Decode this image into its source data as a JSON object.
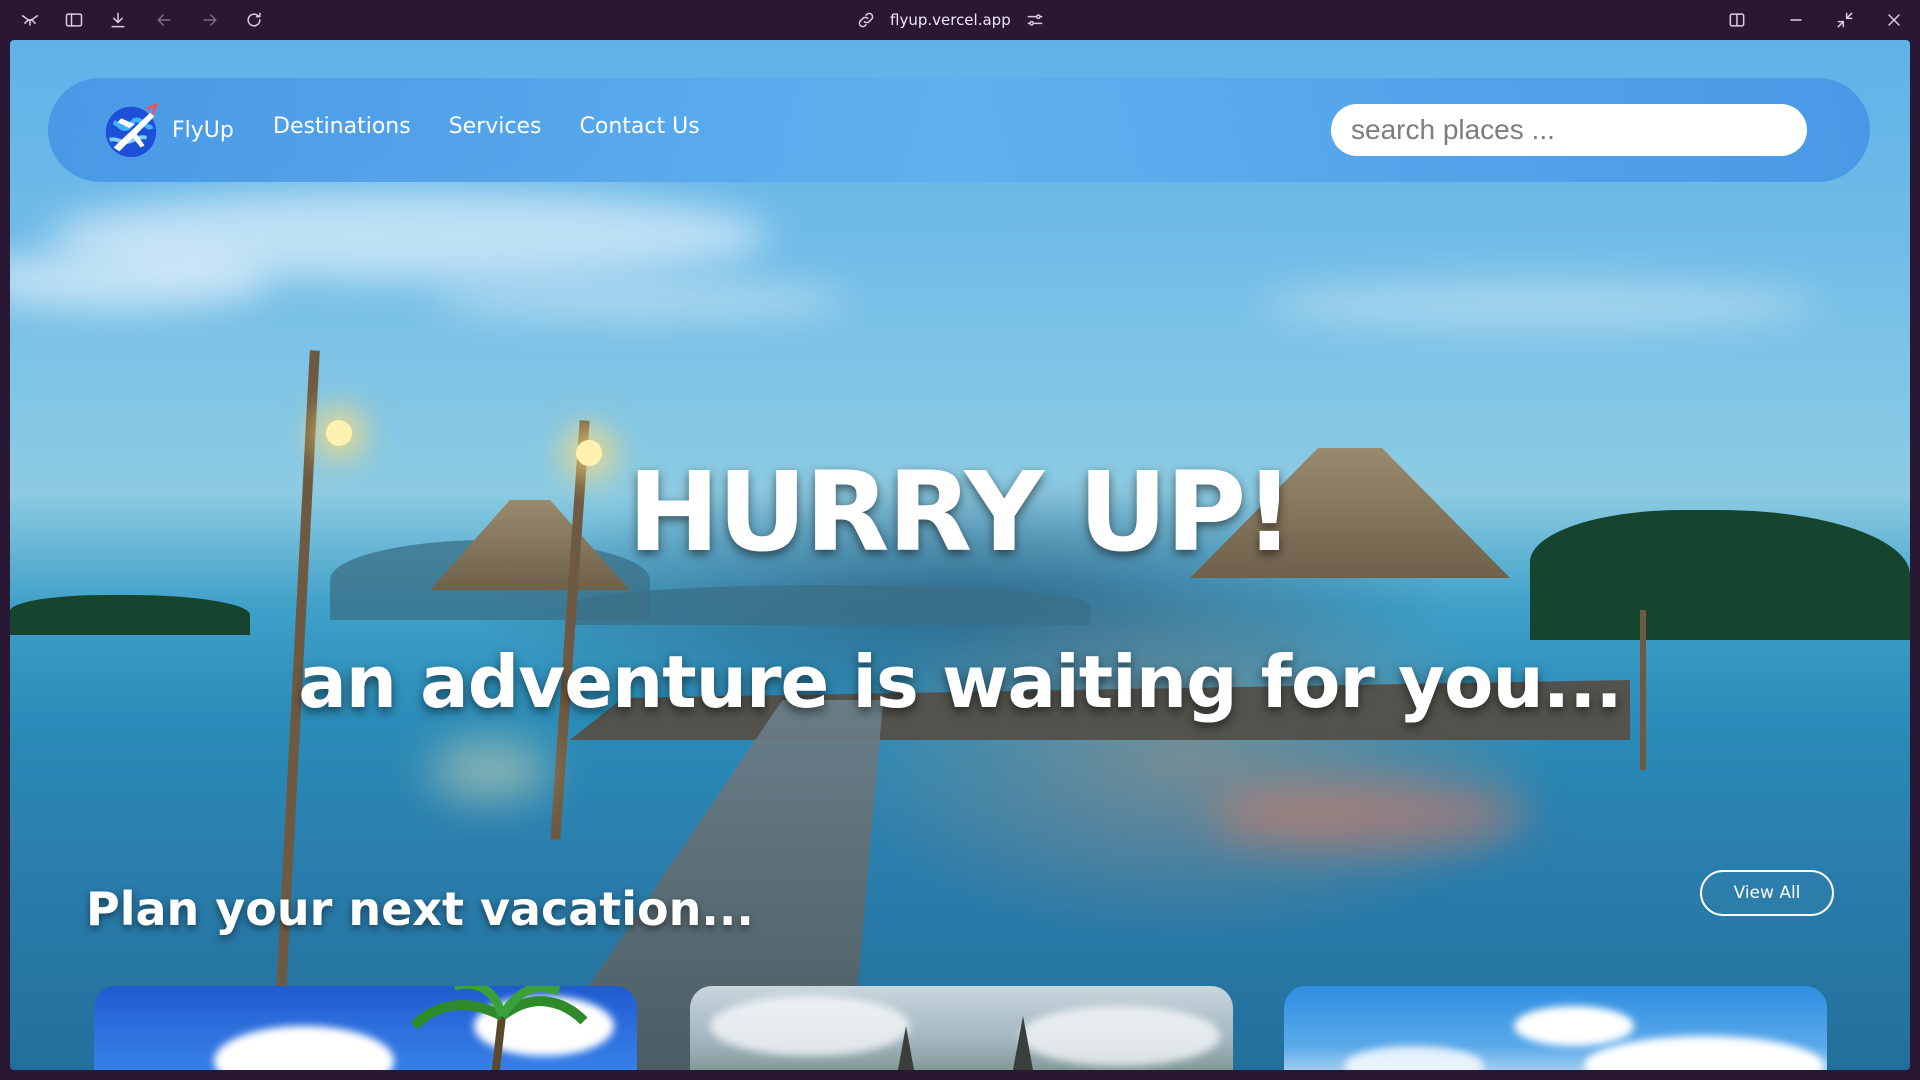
{
  "browser": {
    "url": "flyup.vercel.app",
    "icons": [
      "app-logo-icon",
      "sidebar-toggle-icon",
      "download-icon",
      "back-icon",
      "forward-icon",
      "reload-icon",
      "link-icon",
      "site-settings-icon",
      "split-view-icon",
      "minimize-icon",
      "restore-icon",
      "close-icon"
    ]
  },
  "navbar": {
    "brand": "FlyUp",
    "links": [
      "Destinations",
      "Services",
      "Contact Us"
    ],
    "search_placeholder": "search places ..."
  },
  "hero": {
    "title": "HURRY UP!",
    "subtitle": "an adventure is waiting for you..."
  },
  "plan": {
    "title": "Plan your next vacation...",
    "view_all": "View All"
  },
  "colors": {
    "chrome_bg": "#2b1634",
    "navbar_bg": "#4f9ee6",
    "accent_white": "#ffffff"
  }
}
